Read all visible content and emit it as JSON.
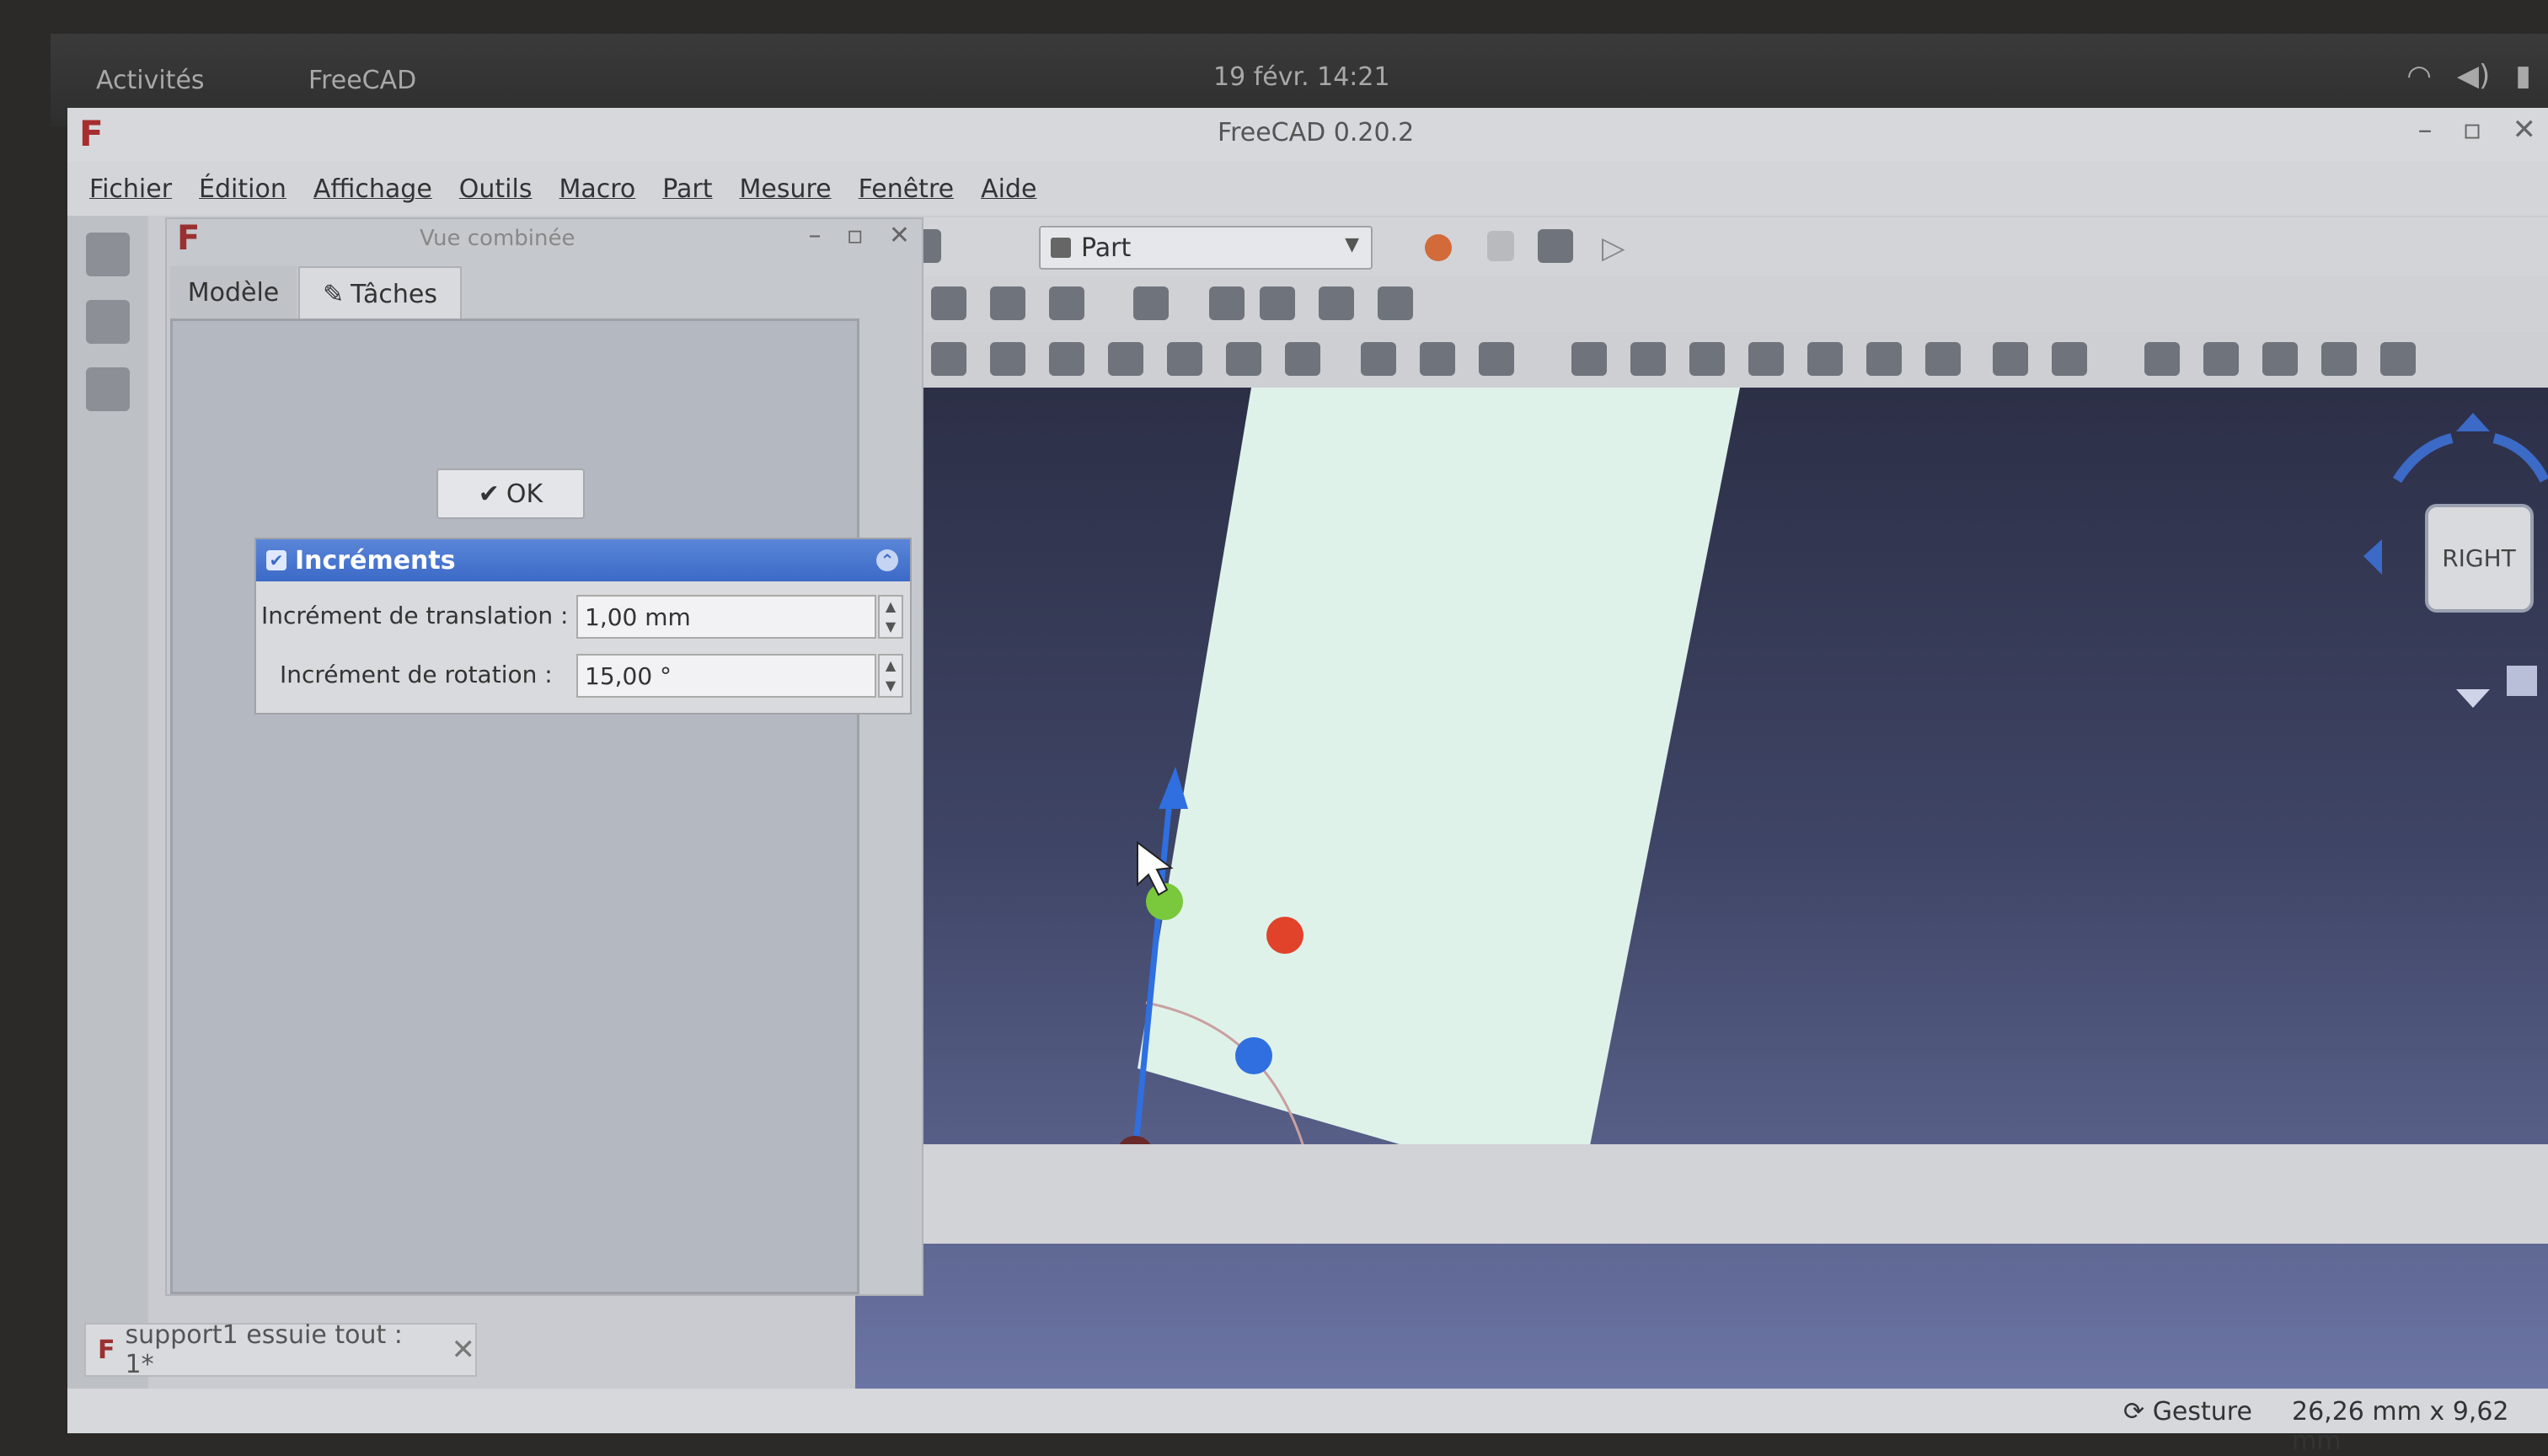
{
  "system_bar": {
    "activities": "Activités",
    "app_name": "FreeCAD",
    "clock": "19 févr.  14:21"
  },
  "window": {
    "title": "FreeCAD 0.20.2"
  },
  "menubar": {
    "items": [
      "Fichier",
      "Édition",
      "Affichage",
      "Outils",
      "Macro",
      "Part",
      "Mesure",
      "Fenêtre",
      "Aide"
    ]
  },
  "combo_view": {
    "title": "Vue combinée",
    "tabs": [
      "Modèle",
      "Tâches"
    ],
    "ok_label": "OK",
    "increments": {
      "title": "Incréments",
      "translation_label": "Incrément de translation :",
      "translation_value": "1,00 mm",
      "rotation_label": "Incrément de rotation :",
      "rotation_value": "15,00 °"
    }
  },
  "toolbar": {
    "workbench": "Part",
    "record_macro_color": "#d26a3a"
  },
  "navigation_cube": {
    "face_label": "RIGHT"
  },
  "document_tab": {
    "label": "support1 essuie tout : 1*"
  },
  "statusbar": {
    "navigation_style": "Gesture",
    "dimensions": "26,26 mm x 9,62 mm"
  },
  "icons": {
    "freecad_logo": "freecad-logo-icon",
    "wifi": "wifi-icon",
    "volume": "volume-icon",
    "battery": "battery-icon"
  },
  "colors": {
    "increments_header": "#3b6ac7",
    "sketch_plane": "#dff2ea",
    "gizmo_x": "#3cc43c",
    "gizmo_y": "#2f6fe0",
    "gizmo_rot_red": "#e0432a"
  }
}
